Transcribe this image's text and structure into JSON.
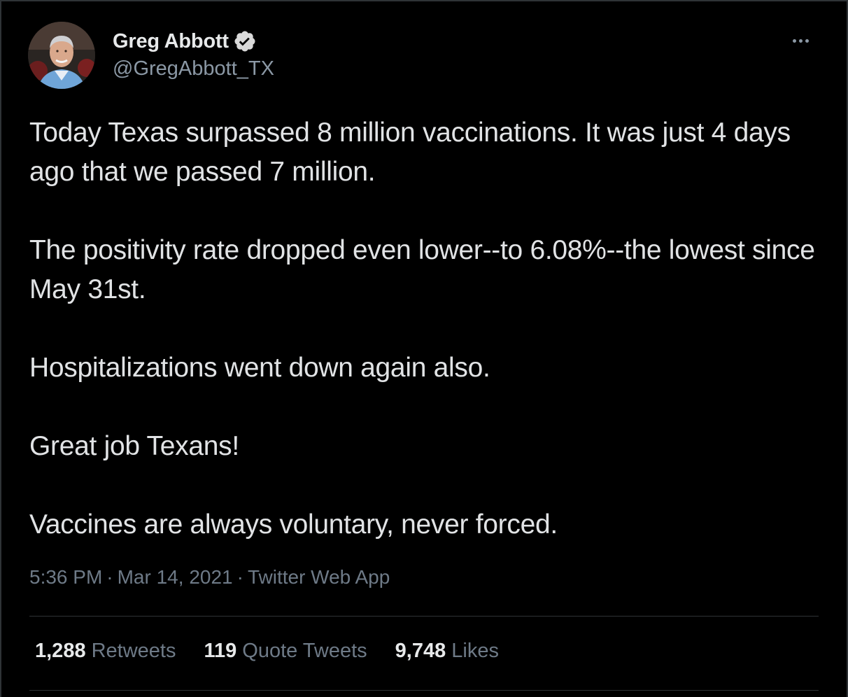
{
  "author": {
    "display_name": "Greg Abbott",
    "handle": "@GregAbbott_TX",
    "verified": true,
    "avatar_icon": "profile-photo"
  },
  "more_icon": "more-options-icon",
  "tweet": {
    "paragraphs": [
      "Today Texas surpassed 8 million vaccinations. It was just 4 days ago that we passed 7 million.",
      "The positivity rate dropped even lower--to 6.08%--the lowest since May 31st.",
      "Hospitalizations went down again also.",
      "Great job Texans!",
      "Vaccines are always voluntary, never forced."
    ]
  },
  "meta": {
    "time": "5:36 PM",
    "separator": "·",
    "date": "Mar 14, 2021",
    "source": "Twitter Web App"
  },
  "stats": {
    "retweets": {
      "count": "1,288",
      "label": "Retweets"
    },
    "quotes": {
      "count": "119",
      "label": "Quote Tweets"
    },
    "likes": {
      "count": "9,748",
      "label": "Likes"
    }
  },
  "colors": {
    "background": "#000000",
    "text": "#e1e3e5",
    "muted": "#6e7a87",
    "divider": "#2f3336",
    "verified_badge": "#d9d9d9"
  }
}
